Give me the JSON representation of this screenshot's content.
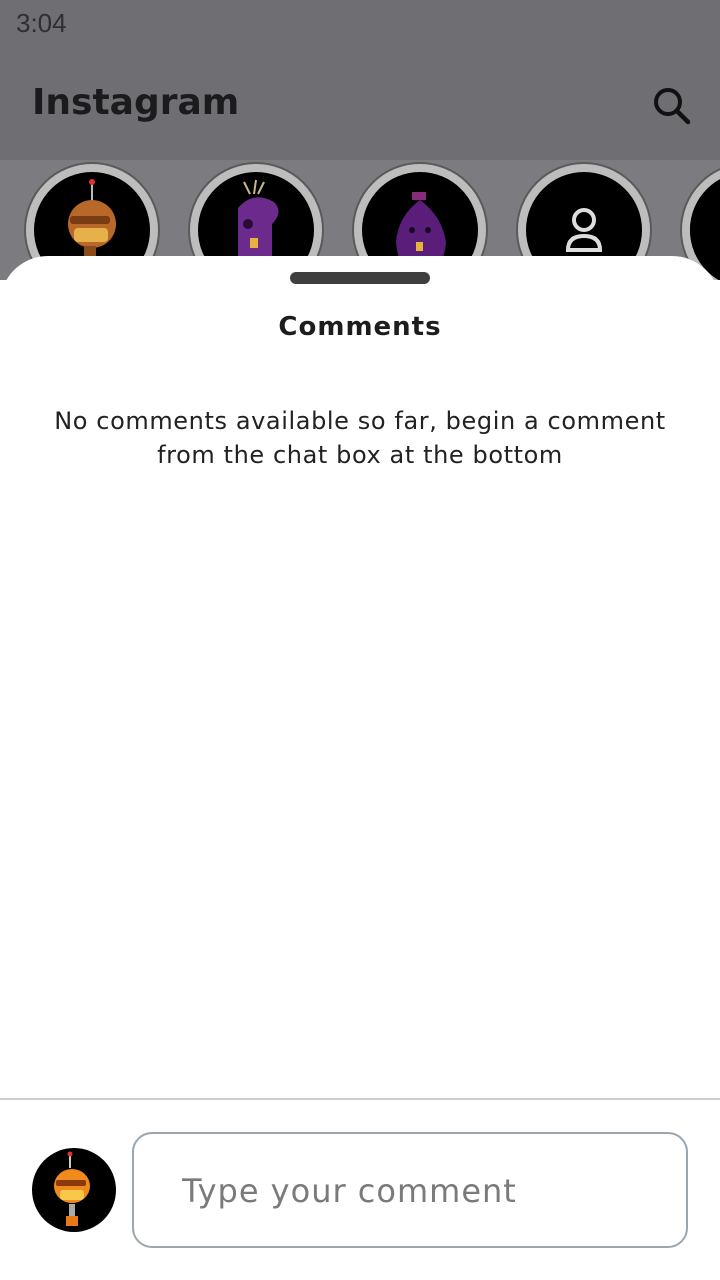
{
  "status_bar": {
    "time": "3:04"
  },
  "header": {
    "title": "Instagram",
    "search_icon": "search-icon"
  },
  "stories": [
    {
      "icon": "robot-avatar-icon"
    },
    {
      "icon": "purple-creature-avatar-icon"
    },
    {
      "icon": "purple-blob-avatar-icon"
    },
    {
      "icon": "person-placeholder-icon"
    },
    {
      "icon": "avatar-icon"
    }
  ],
  "comments_sheet": {
    "title": "Comments",
    "empty_message": "No comments available so far, begin a comment from the chat box at the bottom",
    "input_placeholder": "Type your comment",
    "avatar_icon": "robot-avatar-icon"
  },
  "colors": {
    "overlay": "#6f6e73",
    "sheet_bg": "#ffffff",
    "input_border": "#9aa6b0"
  }
}
